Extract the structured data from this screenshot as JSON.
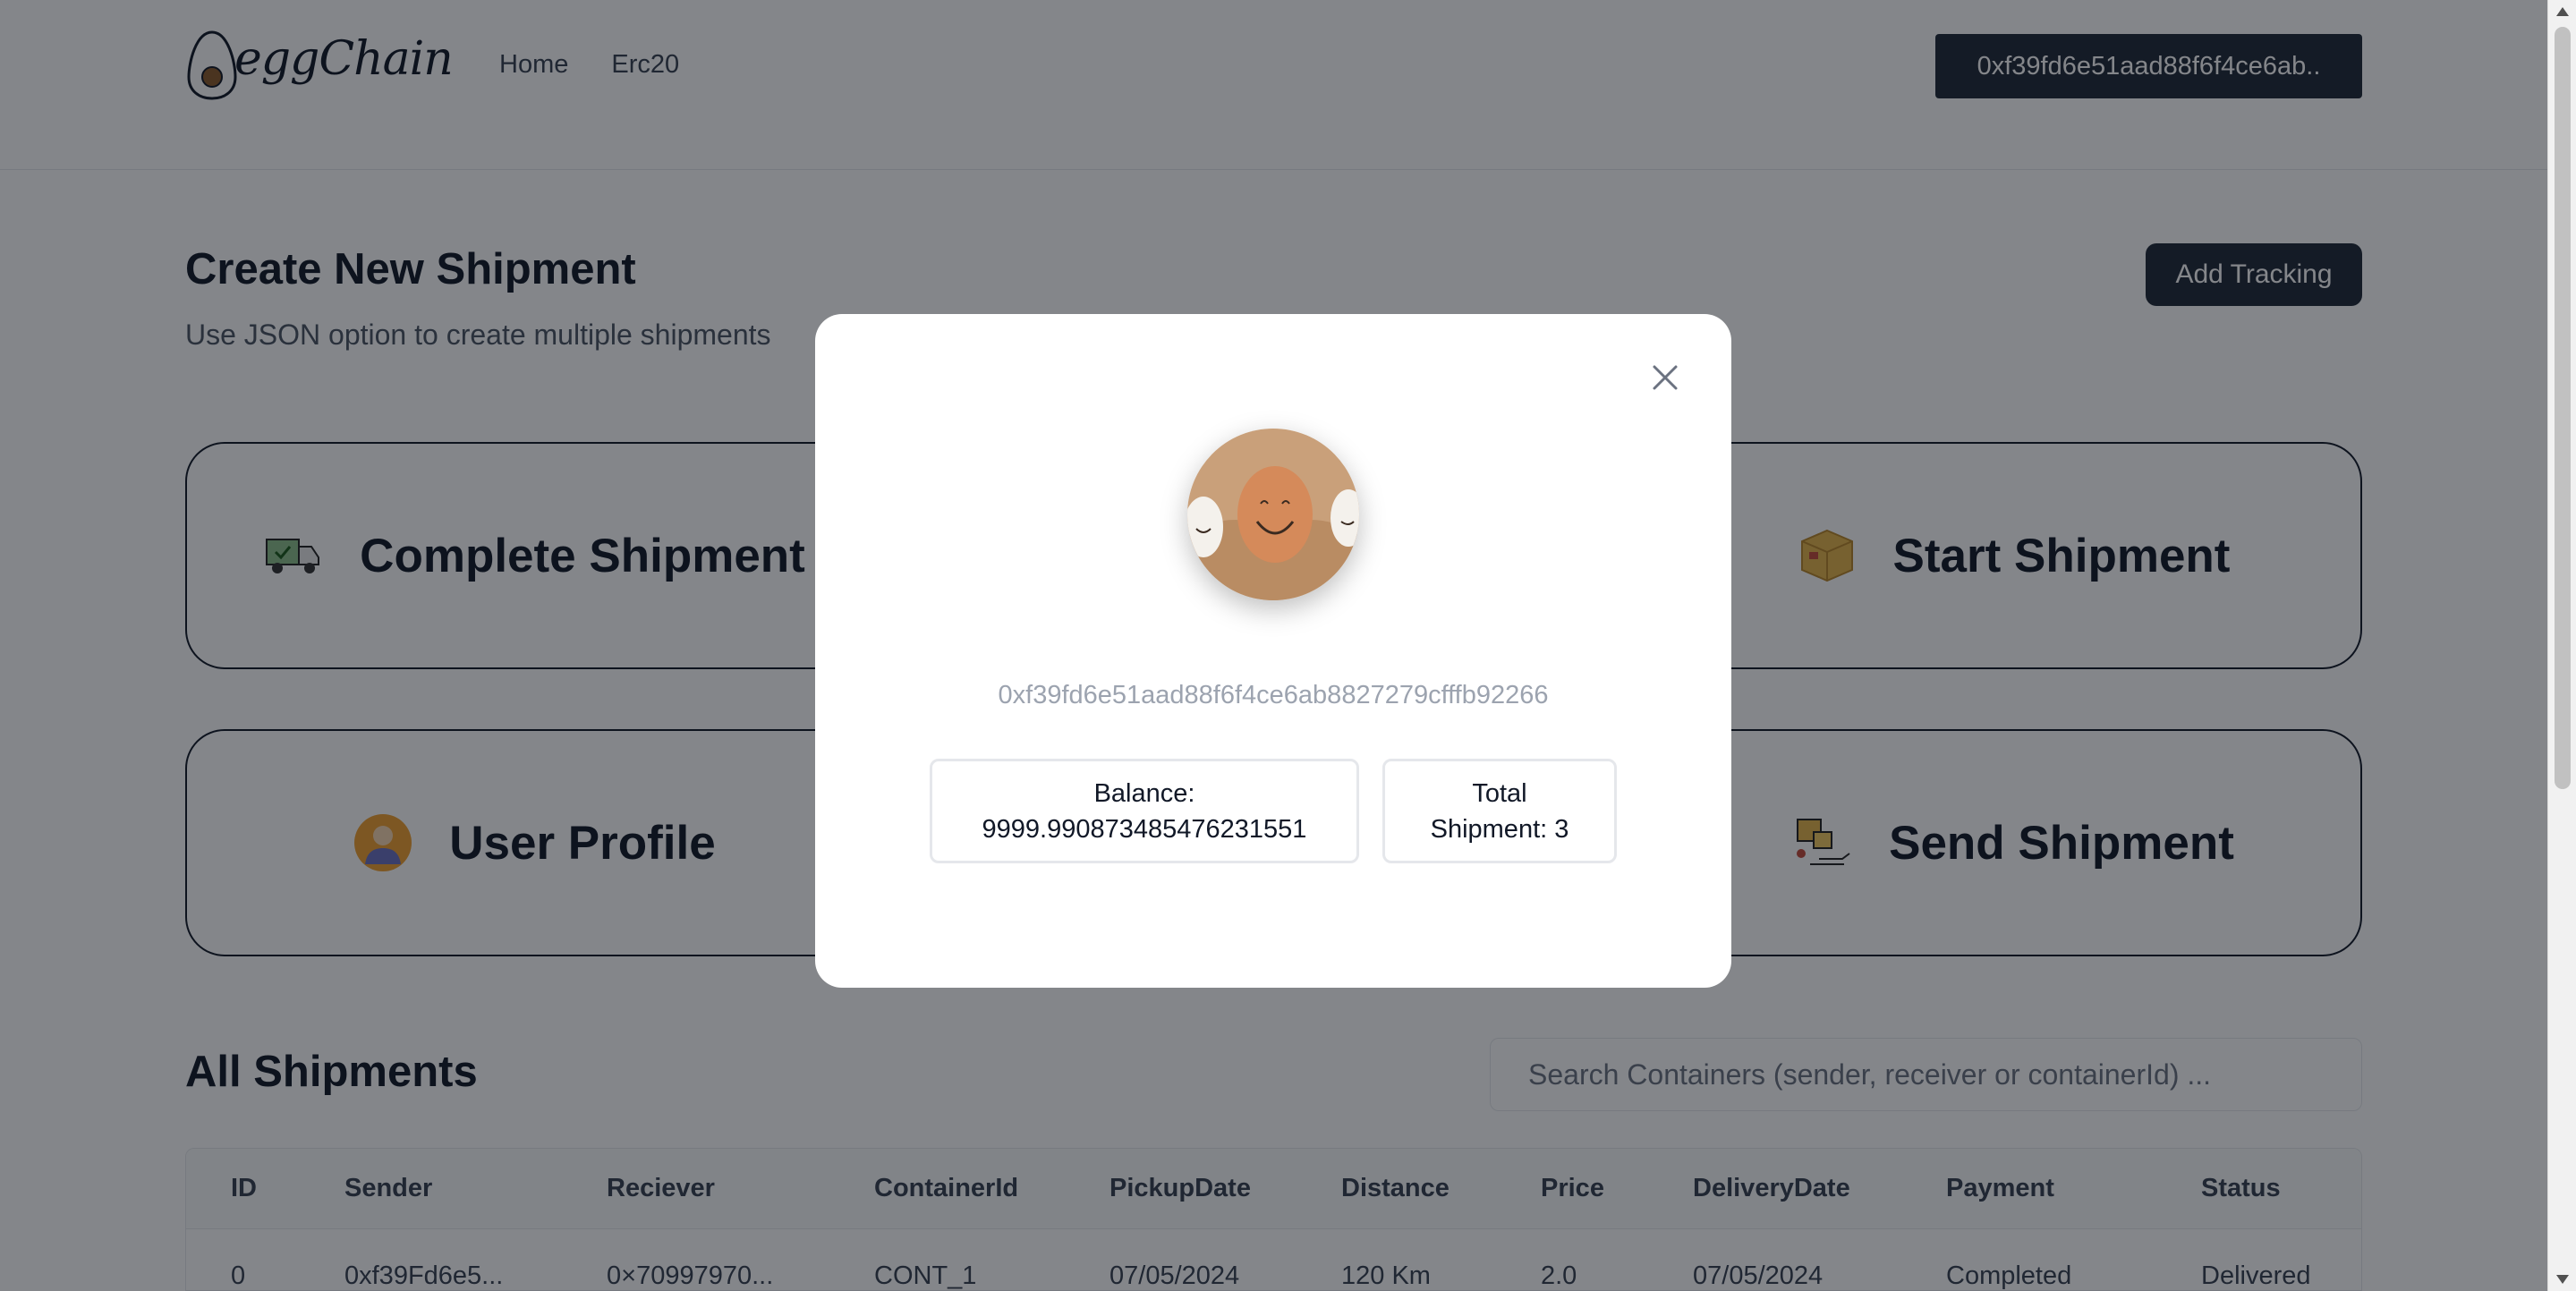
{
  "header": {
    "logo_text": "eggChain",
    "nav": [
      "Home",
      "Erc20"
    ],
    "wallet_button": "0xf39fd6e51aad88f6f4ce6ab.."
  },
  "create": {
    "title": "Create New Shipment",
    "subtitle": "Use JSON option to create multiple shipments",
    "add_tracking": "Add Tracking"
  },
  "cards": {
    "complete": "Complete Shipment",
    "start": "Start Shipment",
    "profile": "User Profile",
    "send": "Send Shipment"
  },
  "shipments": {
    "title": "All Shipments",
    "search_placeholder": "Search Containers (sender, receiver or containerId) ...",
    "columns": [
      "ID",
      "Sender",
      "Reciever",
      "ContainerId",
      "PickupDate",
      "Distance",
      "Price",
      "DeliveryDate",
      "Payment",
      "Status"
    ],
    "rows": [
      [
        "0",
        "0xf39Fd6e5...",
        "0×70997970...",
        "CONT_1",
        "07/05/2024",
        "120 Km",
        "2.0",
        "07/05/2024",
        "Completed",
        "Delivered"
      ]
    ]
  },
  "modal": {
    "address": "0xf39fd6e51aad88f6f4ce6ab8827279cfffb92266",
    "balance_label": "Balance:",
    "balance_value": "9999.990873485476231551",
    "total_label": "Total",
    "total_value": "Shipment: 3",
    "close_icon": "close-icon",
    "avatar_icon": "egg-avatar-icon"
  }
}
